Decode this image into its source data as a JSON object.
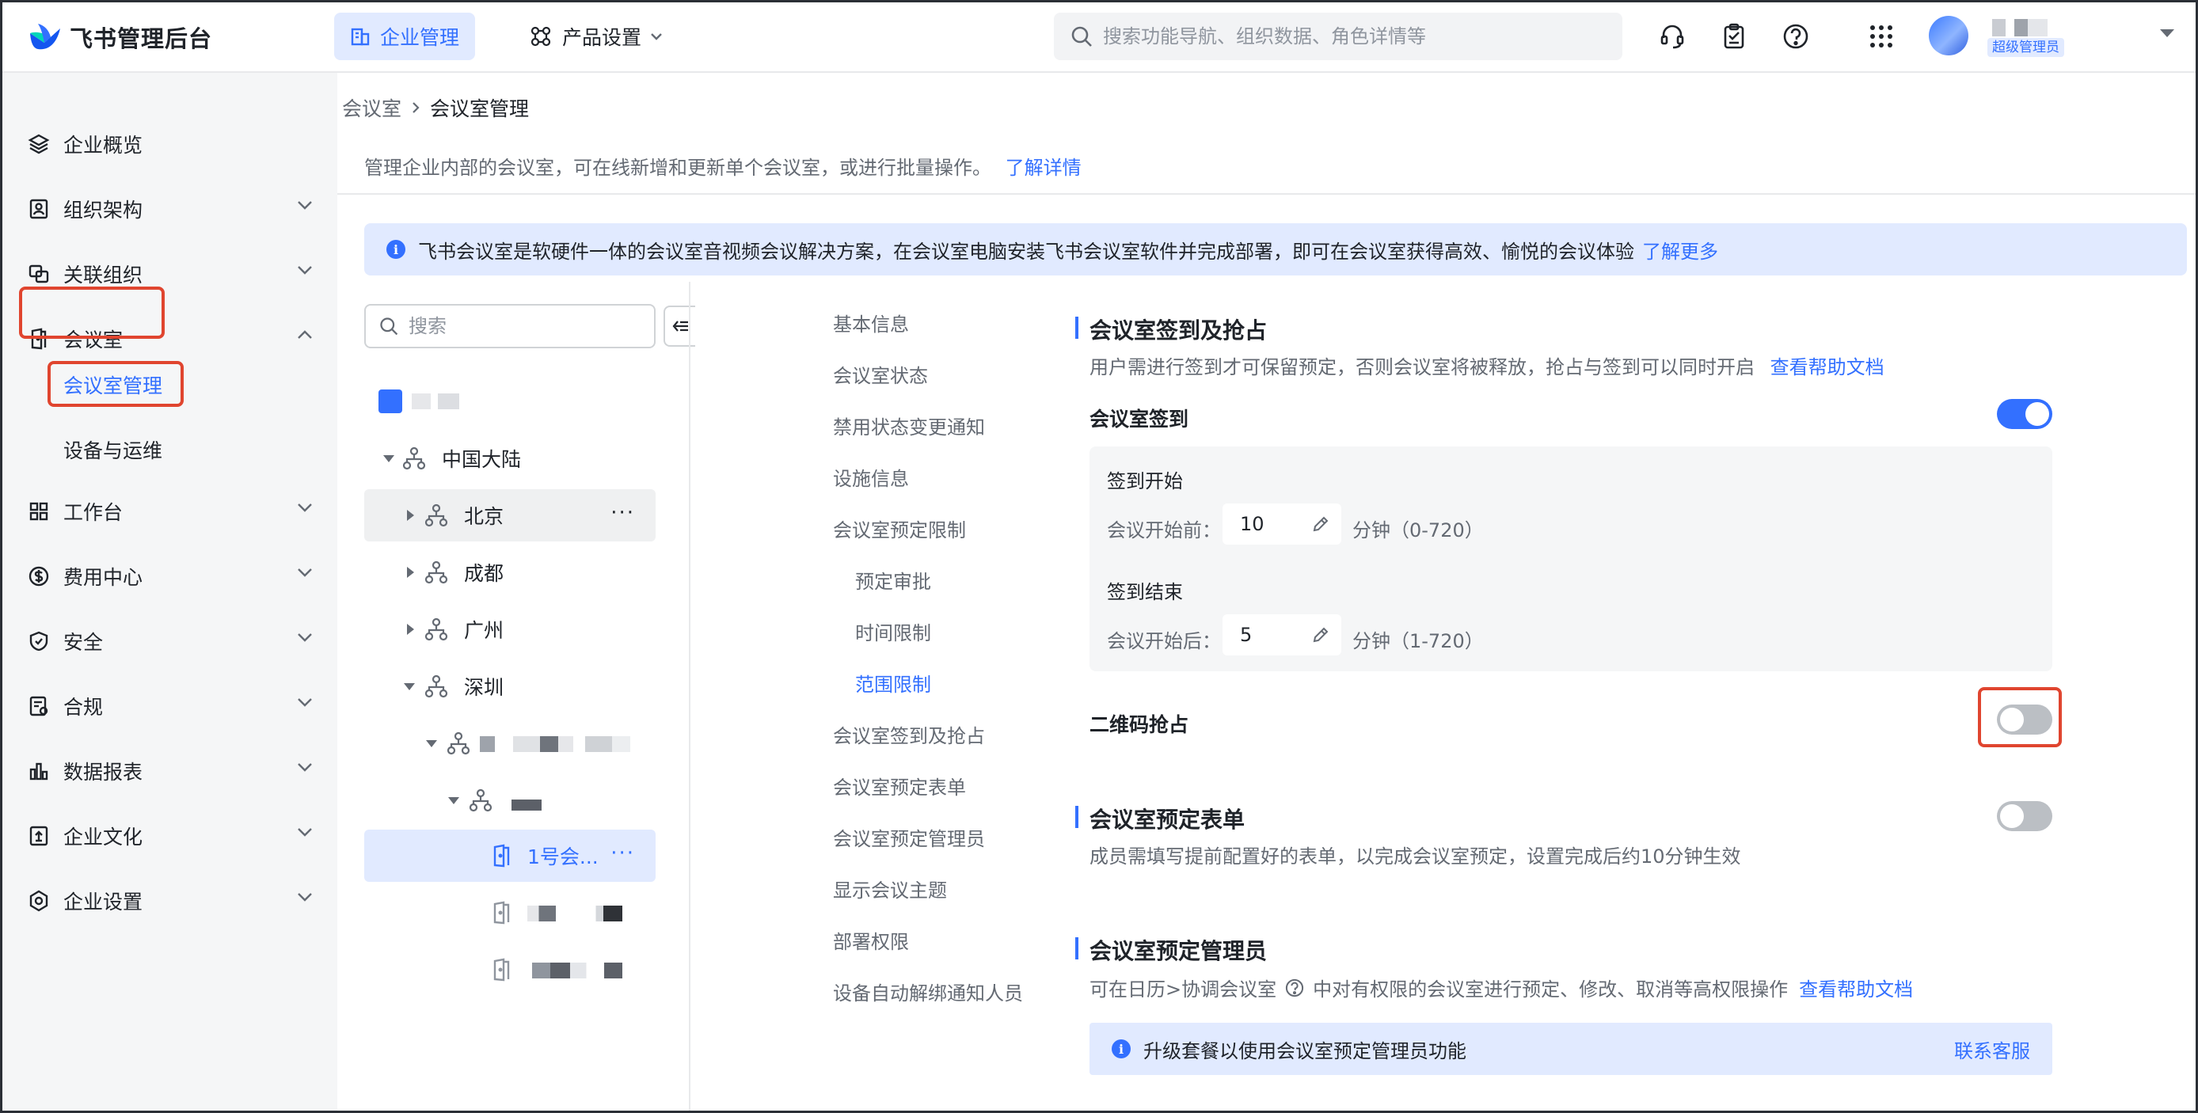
{
  "header": {
    "brand": "飞书管理后台",
    "tabs": [
      {
        "label": "企业管理"
      },
      {
        "label": "产品设置"
      }
    ],
    "search_placeholder": "搜索功能导航、组织数据、角色详情等",
    "role_badge": "超级管理员",
    "icons": [
      "headset-icon",
      "clipboard-icon",
      "help-icon",
      "apps-grid-icon"
    ]
  },
  "sidebar": {
    "items": [
      {
        "label": "企业概览",
        "icon": "layers-icon"
      },
      {
        "label": "组织架构",
        "icon": "contact-card-icon"
      },
      {
        "label": "关联组织",
        "icon": "linked-org-icon"
      },
      {
        "label": "会议室",
        "icon": "door-icon"
      },
      {
        "label": "工作台",
        "icon": "grid-icon"
      },
      {
        "label": "费用中心",
        "icon": "coin-icon"
      },
      {
        "label": "安全",
        "icon": "shield-icon"
      },
      {
        "label": "合规",
        "icon": "compliance-icon"
      },
      {
        "label": "数据报表",
        "icon": "bar-chart-icon"
      },
      {
        "label": "企业文化",
        "icon": "culture-icon"
      },
      {
        "label": "企业设置",
        "icon": "settings-icon"
      }
    ],
    "sub_items": [
      {
        "label": "会议室管理",
        "active": true
      },
      {
        "label": "设备与运维",
        "active": false
      }
    ]
  },
  "breadcrumb": {
    "parent": "会议室",
    "current": "会议室管理"
  },
  "description": {
    "text": "管理企业内部的会议室，可在线新增和更新单个会议室，或进行批量操作。",
    "link": "了解详情"
  },
  "notice": {
    "text": "飞书会议室是软硬件一体的会议室音视频会议解决方案，在会议室电脑安装飞书会议室软件并完成部署，即可在会议室获得高效、愉悦的会议体验",
    "link": "了解更多"
  },
  "tree": {
    "search_placeholder": "搜索",
    "nodes": [
      {
        "label": "中国大陆"
      },
      {
        "label": "北京"
      },
      {
        "label": "成都"
      },
      {
        "label": "广州"
      },
      {
        "label": "深圳"
      },
      {
        "label": "1号会..."
      }
    ],
    "more": "···"
  },
  "anchors": [
    {
      "label": "基本信息"
    },
    {
      "label": "会议室状态"
    },
    {
      "label": "禁用状态变更通知"
    },
    {
      "label": "设施信息"
    },
    {
      "label": "会议室预定限制"
    },
    {
      "label": "预定审批"
    },
    {
      "label": "时间限制"
    },
    {
      "label": "范围限制"
    },
    {
      "label": "会议室签到及抢占"
    },
    {
      "label": "会议室预定表单"
    },
    {
      "label": "会议室预定管理员"
    },
    {
      "label": "显示会议主题"
    },
    {
      "label": "部署权限"
    },
    {
      "label": "设备自动解绑通知人员"
    }
  ],
  "checkin": {
    "title": "会议室签到及抢占",
    "desc": "用户需进行签到才可保留预定，否则会议室将被释放，抢占与签到可以同时开启",
    "help_link": "查看帮助文档",
    "checkin_label": "会议室签到",
    "checkin_enabled": true,
    "start_title": "签到开始",
    "start_prefix": "会议开始前：",
    "start_value": "10",
    "start_unit": "分钟（0-720）",
    "end_title": "签到结束",
    "end_prefix": "会议开始后：",
    "end_value": "5",
    "end_unit": "分钟（1-720）",
    "qr_label": "二维码抢占",
    "qr_enabled": false
  },
  "form_section": {
    "title": "会议室预定表单",
    "desc": "成员需填写提前配置好的表单，以完成会议室预定，设置完成后约10分钟生效",
    "enabled": false
  },
  "admin_section": {
    "title": "会议室预定管理员",
    "desc_a": "可在日历>协调会议室",
    "desc_b": "中对有权限的会议室进行预定、修改、取消等高权限操作",
    "help_link": "查看帮助文档",
    "upgrade_text": "升级套餐以使用会议室预定管理员功能",
    "contact": "联系客服"
  },
  "colors": {
    "accent": "#3370ff",
    "highlight": "#e0452f",
    "sidebar_bg": "#f5f6f7"
  }
}
